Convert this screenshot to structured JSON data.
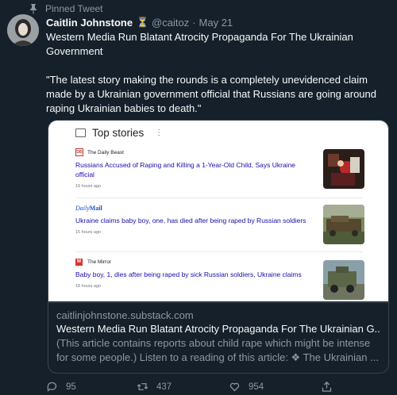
{
  "pinned_label": "Pinned Tweet",
  "author": {
    "name": "Caitlin Johnstone",
    "badge_icon": "hourglass-icon",
    "handle": "@caitoz",
    "separator": "·",
    "date": "May 21"
  },
  "tweet": {
    "text_line1": "Western Media Run Blatant Atrocity Propaganda For The Ukrainian Government",
    "text_quote": "\"The latest story making the rounds is a completely unevidenced claim made by a Ukrainian government official that Russians are going around raping Ukrainian babies to death.\""
  },
  "card_image": {
    "section_title": "Top stories",
    "stories": [
      {
        "source": "The Daily Beast",
        "headline": "Russians Accused of Raping and Killing a 1-Year-Old Child, Says Ukraine official",
        "time": "19 hours ago"
      },
      {
        "source_logo": "Daily Mail",
        "headline": "Ukraine claims baby boy, one, has died after being raped by Russian soldiers",
        "time": "15 hours ago"
      },
      {
        "source": "The Mirror",
        "headline": "Baby boy, 1, dies after being raped by sick Russian soldiers, Ukraine claims",
        "time": "18 hours ago"
      }
    ]
  },
  "card": {
    "domain": "caitlinjohnstone.substack.com",
    "title": "Western Media Run Blatant Atrocity Propaganda For The Ukrainian G...",
    "description": "(This article contains reports about child rape which might be intense for some people.) Listen to a reading of this article: ❖ The Ukrainian ..."
  },
  "actions": {
    "replies": "95",
    "retweets": "437",
    "likes": "954"
  },
  "colors": {
    "background": "#15202b",
    "text": "#f7f9f9",
    "muted": "#8b98a5",
    "link_blue": "#1a0dab"
  }
}
